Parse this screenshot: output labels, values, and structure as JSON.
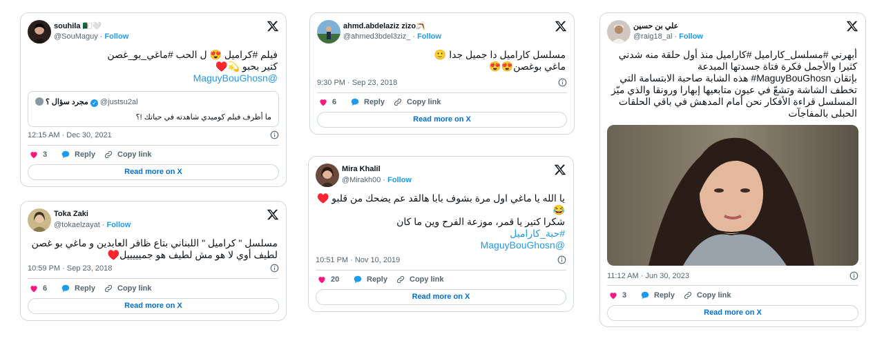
{
  "common": {
    "follow": "Follow",
    "reply": "Reply",
    "copy_link": "Copy link",
    "read_more": "Read more on X",
    "dot": "·"
  },
  "tweets": [
    {
      "name": "souhila 🇩🇿🤍",
      "handle": "@SouMaguy",
      "lines": [
        "فيلم #كراميل 😍 ل الحب #ماغي_بو_غصن",
        "كتير بحبو 💫♥️",
        "@MaguyBouGhosn"
      ],
      "quote": {
        "name": "مجرد سؤال ؟",
        "handle": "@justsu2al",
        "text": "ما أظرف فيلم كوميدي شاهدته في حياتك !؟"
      },
      "timestamp": "12:15 AM · Dec 30, 2021",
      "likes": "3"
    },
    {
      "name": "Toka Zaki",
      "handle": "@tokaelzayat",
      "lines": [
        "مسلسل \" كراميل \" اللبناني بتاع ظافر العابدين و ماغي بو غصن",
        "لطيف أوي لا هو مش لطيف هو جميييييل♥️"
      ],
      "timestamp": "10:59 PM · Sep 23, 2018",
      "likes": "6"
    },
    {
      "name": "ahmd.abdelaziz zizo🪃",
      "handle": "@ahmed3bdel3ziz_",
      "lines": [
        "مسلسل كاراميل دا جميل جدا 🙂",
        "ماغي بوغصن😍😍"
      ],
      "timestamp": "9:30 PM · Sep 23, 2018",
      "likes": "6"
    },
    {
      "name": "Mira Khalil",
      "handle": "@Mirakh00",
      "lines": [
        "يا الله يا ماغي اول مرة بشوف بابا هالقد عم يضحك من قلبو ♥️",
        "😂",
        "شكرا كتير يا قمر، موزعة الفرح وين ما كان",
        "#حبة_كاراميل",
        "@MaguyBouGhosn"
      ],
      "timestamp": "10:51 PM · Nov 10, 2019",
      "likes": "20"
    },
    {
      "name": "علي بن حسين",
      "handle": "@raig18_al",
      "lines": [
        "أبهرني #مسلسل_كاراميل #كاراميل منذ أول حلقة منه شدني",
        "كثيرا والأجمل فكرة فتاة جسدتها المبدعة",
        "بإتقان MaguyBouGhosn# هذه الشابة صاحبة الابتسامة التي",
        "تخطف الشاشة وتشعّ في عيون متابعيها إبهارا ورونقا والذي ميّز",
        "المسلسل قراءة الأفكار نحن أمام المدهش في باقي الحلقات",
        "الحبلى بالمفاجآت"
      ],
      "timestamp": "11:12 AM · Jun 30, 2023",
      "likes": "3"
    }
  ],
  "colors": {
    "link": "#1d9bf0",
    "heart": "#f91880",
    "reply": "#1d9bf0",
    "border": "#cfd9de"
  },
  "icons": [
    "x-logo-icon",
    "heart-icon",
    "reply-bubble-icon",
    "link-icon",
    "info-icon",
    "verified-badge-icon"
  ]
}
